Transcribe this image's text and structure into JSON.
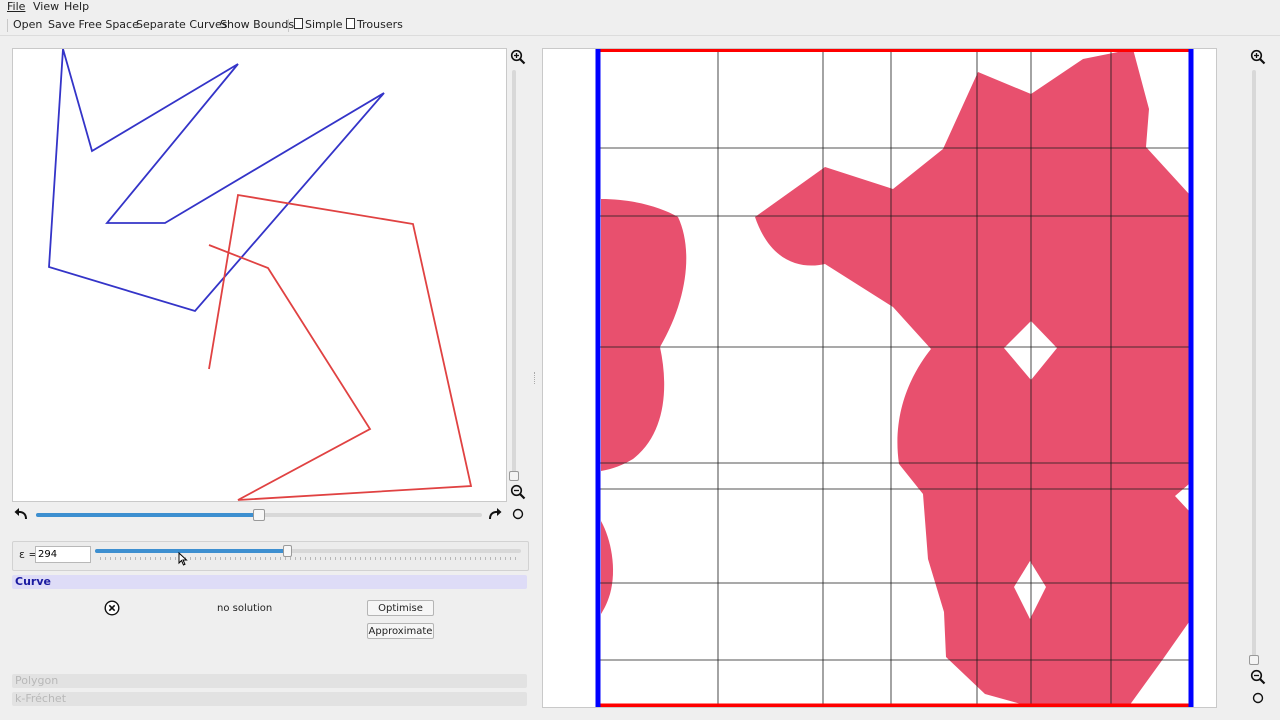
{
  "menu": {
    "file": "File",
    "view": "View",
    "help": "Help"
  },
  "toolbar": {
    "open": "Open",
    "save_free_space": "Save Free Space",
    "separate_curves": "Separate Curves",
    "show_bounds": "Show Bounds",
    "simple": "Simple",
    "trousers": "Trousers"
  },
  "icons": {
    "zoom_in": "zoom-in-icon",
    "zoom_out": "zoom-out-icon",
    "zoom_reset": "circle-icon",
    "undo": "undo-icon",
    "redo": "redo-icon",
    "no_solution": "cross-circle-icon"
  },
  "colors": {
    "curve_p": "#3434c8",
    "curve_q": "#e04242",
    "free_space": "#e8506e",
    "bound_left_right": "#0000ff",
    "bound_top_bottom": "#ff0000",
    "slider_fill": "#3d8fd0"
  },
  "history_slider": {
    "value": 0.5
  },
  "zoom_slider_left": {
    "value": 0.0
  },
  "zoom_slider_right": {
    "value": 0.0
  },
  "epsilon": {
    "label": "ε =",
    "value": "294",
    "slider_value": 0.45
  },
  "curve_panel": {
    "title": "Curve",
    "status": "no solution",
    "optimise": "Optimise",
    "approximate": "Approximate"
  },
  "sections": {
    "polygon": "Polygon",
    "kfrechet": "k-Fréchet"
  }
}
